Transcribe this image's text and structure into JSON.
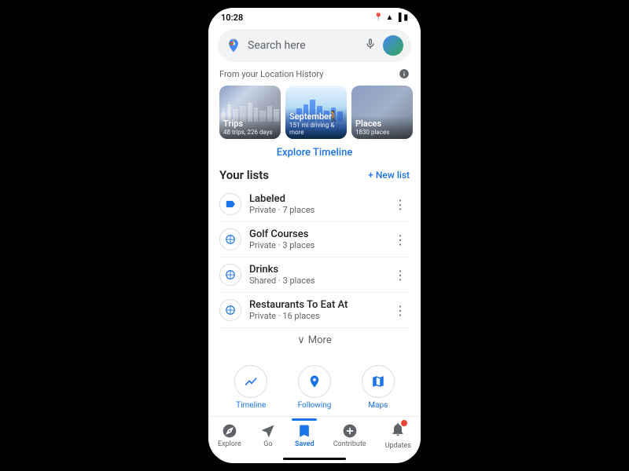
{
  "status_bar": {
    "time": "10:28"
  },
  "search": {
    "placeholder": "Search here"
  },
  "location_history": {
    "label": "From your Location History"
  },
  "timeline_cards": [
    {
      "id": "trips",
      "title": "Trips",
      "subtitle": "48 trips, 226 days",
      "type": "trips"
    },
    {
      "id": "september",
      "title": "September",
      "subtitle": "151 mi driving & more",
      "type": "september"
    },
    {
      "id": "places",
      "title": "Places",
      "subtitle": "1830 places",
      "type": "places"
    }
  ],
  "explore_timeline": "Explore Timeline",
  "your_lists": {
    "title": "Your lists",
    "new_list": "+ New list"
  },
  "lists": [
    {
      "name": "Labeled",
      "meta": "Private · 7 places",
      "icon": "P",
      "type": "labeled"
    },
    {
      "name": "Golf Courses",
      "meta": "Private · 3 places",
      "icon": "G",
      "type": "golf"
    },
    {
      "name": "Drinks",
      "meta": "Shared · 3 places",
      "icon": "G",
      "type": "drinks"
    },
    {
      "name": "Restaurants To Eat At",
      "meta": "Private · 16 places",
      "icon": "G",
      "type": "restaurants"
    }
  ],
  "more_button": "More",
  "quick_actions": [
    {
      "label": "Timeline",
      "icon": "timeline"
    },
    {
      "label": "Following",
      "icon": "following"
    },
    {
      "label": "Maps",
      "icon": "maps"
    }
  ],
  "bottom_nav": [
    {
      "label": "Explore",
      "icon": "explore",
      "active": false
    },
    {
      "label": "Go",
      "icon": "go",
      "active": false
    },
    {
      "label": "Saved",
      "icon": "saved",
      "active": true
    },
    {
      "label": "Contribute",
      "icon": "contribute",
      "active": false
    },
    {
      "label": "Updates",
      "icon": "updates",
      "active": false,
      "badge": true
    }
  ]
}
